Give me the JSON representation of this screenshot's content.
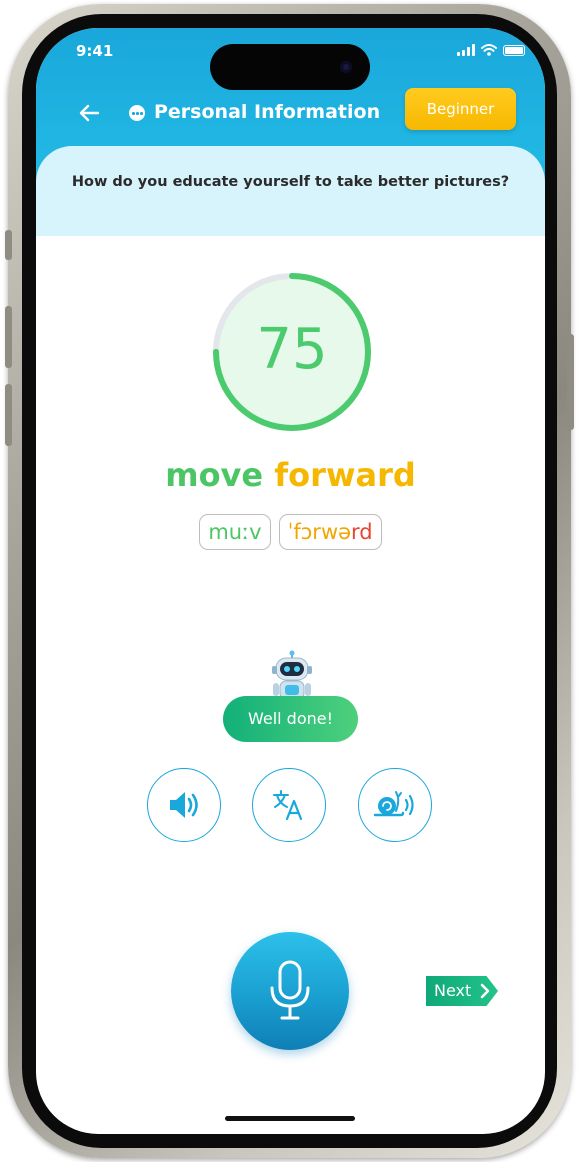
{
  "status_bar": {
    "time": "9:41"
  },
  "header": {
    "title": "Personal Information",
    "level_badge": "Beginner"
  },
  "question": "How do you educate yourself to take better pictures?",
  "score": {
    "value": "75",
    "fraction": 0.75
  },
  "phrase": {
    "words": [
      {
        "text": "move",
        "status": "good"
      },
      {
        "text": "forward",
        "status": "fair"
      }
    ],
    "ipa": {
      "word1": {
        "main": "muːv"
      },
      "word2": {
        "part1": "ˈfɔrw",
        "part2": "ə",
        "part3": "rd"
      }
    }
  },
  "feedback": {
    "message": "Well done!"
  },
  "actions": {
    "play_icon": "speaker-icon",
    "translate_icon": "translate-icon",
    "slow_icon": "snail-speaker-icon"
  },
  "record": {
    "icon": "microphone-icon"
  },
  "next": {
    "label": "Next"
  },
  "colors": {
    "primary_blue": "#1aa7db",
    "good_green": "#4cc665",
    "fair_yellow": "#f5b700",
    "bad_red": "#e84530",
    "badge_yellow": "#ffcb1f",
    "question_bg": "#d7f3fb"
  }
}
